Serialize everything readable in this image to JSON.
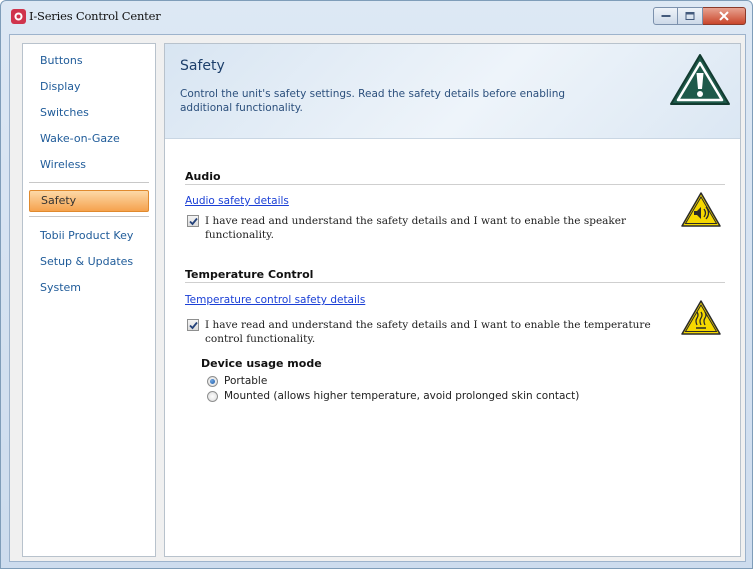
{
  "window": {
    "title": "I-Series Control Center"
  },
  "sidebar": {
    "items": [
      {
        "label": "Buttons"
      },
      {
        "label": "Display"
      },
      {
        "label": "Switches"
      },
      {
        "label": "Wake-on-Gaze"
      },
      {
        "label": "Wireless"
      },
      {
        "label": "Safety",
        "selected": true
      },
      {
        "label": "Tobii Product Key"
      },
      {
        "label": "Setup & Updates"
      },
      {
        "label": "System"
      }
    ]
  },
  "header": {
    "title": "Safety",
    "description": "Control the unit's safety settings. Read the safety details before enabling additional functionality.",
    "icon": "warning-triangle-icon"
  },
  "audio": {
    "title": "Audio",
    "link": "Audio safety details",
    "checkbox_label": "I have read and understand the safety details and I want to enable the speaker functionality.",
    "checked": true,
    "icon": "speaker-warning-icon"
  },
  "temperature": {
    "title": "Temperature Control",
    "link": "Temperature control safety details",
    "checkbox_label": "I have read and understand the safety details and I want to enable the temperature control functionality.",
    "checked": true,
    "icon": "hot-surface-warning-icon",
    "usage_mode": {
      "label": "Device usage mode",
      "options": [
        {
          "label": "Portable",
          "selected": true
        },
        {
          "label": "Mounted (allows higher temperature, avoid prolonged skin contact)",
          "selected": false
        }
      ]
    }
  },
  "colors": {
    "accent_orange": "#f5a24e",
    "link_blue": "#1a3fd6",
    "warning_green": "#1e5a4a",
    "warning_yellow": "#f5d800"
  }
}
